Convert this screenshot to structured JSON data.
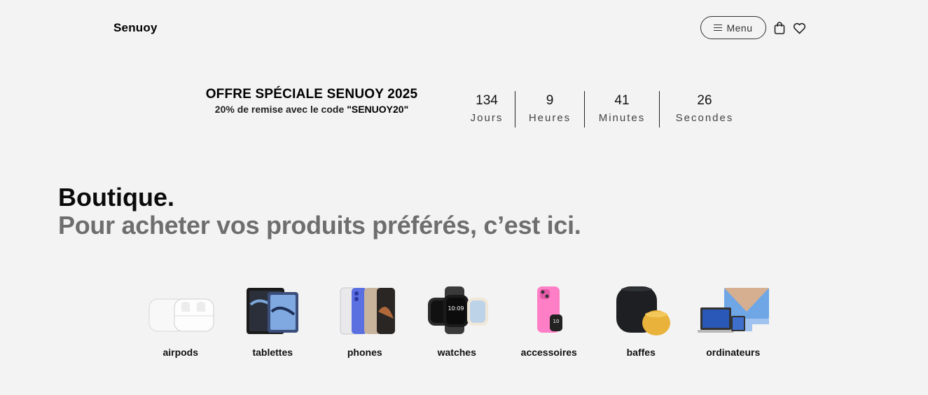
{
  "header": {
    "logo": "Senuoy",
    "menu_label": "Menu",
    "icons": [
      "shopping-bag-icon",
      "heart-icon"
    ]
  },
  "promo": {
    "title": "OFFRE SPÉCIALE SENUOY 2025",
    "subtitle": "20% de remise avec le code",
    "code": "\"SENUOY20\""
  },
  "countdown": [
    {
      "value": "134",
      "label": "Jours"
    },
    {
      "value": "9",
      "label": "Heures"
    },
    {
      "value": "41",
      "label": "Minutes"
    },
    {
      "value": "26",
      "label": "Secondes"
    }
  ],
  "hero": {
    "title": "Boutique.",
    "subtitle": "Pour acheter vos produits préférés, c’est ici."
  },
  "categories": [
    {
      "label": "airpods",
      "icon": "airpods-image"
    },
    {
      "label": "tablettes",
      "icon": "tablets-image"
    },
    {
      "label": "phones",
      "icon": "phones-image"
    },
    {
      "label": "watches",
      "icon": "watches-image"
    },
    {
      "label": "accessoires",
      "icon": "accessories-image"
    },
    {
      "label": "baffes",
      "icon": "speakers-image"
    },
    {
      "label": "ordinateurs",
      "icon": "computers-image"
    }
  ],
  "colors": {
    "background": "#f3f3f3",
    "text": "#111111",
    "muted": "#6e6e6e"
  }
}
